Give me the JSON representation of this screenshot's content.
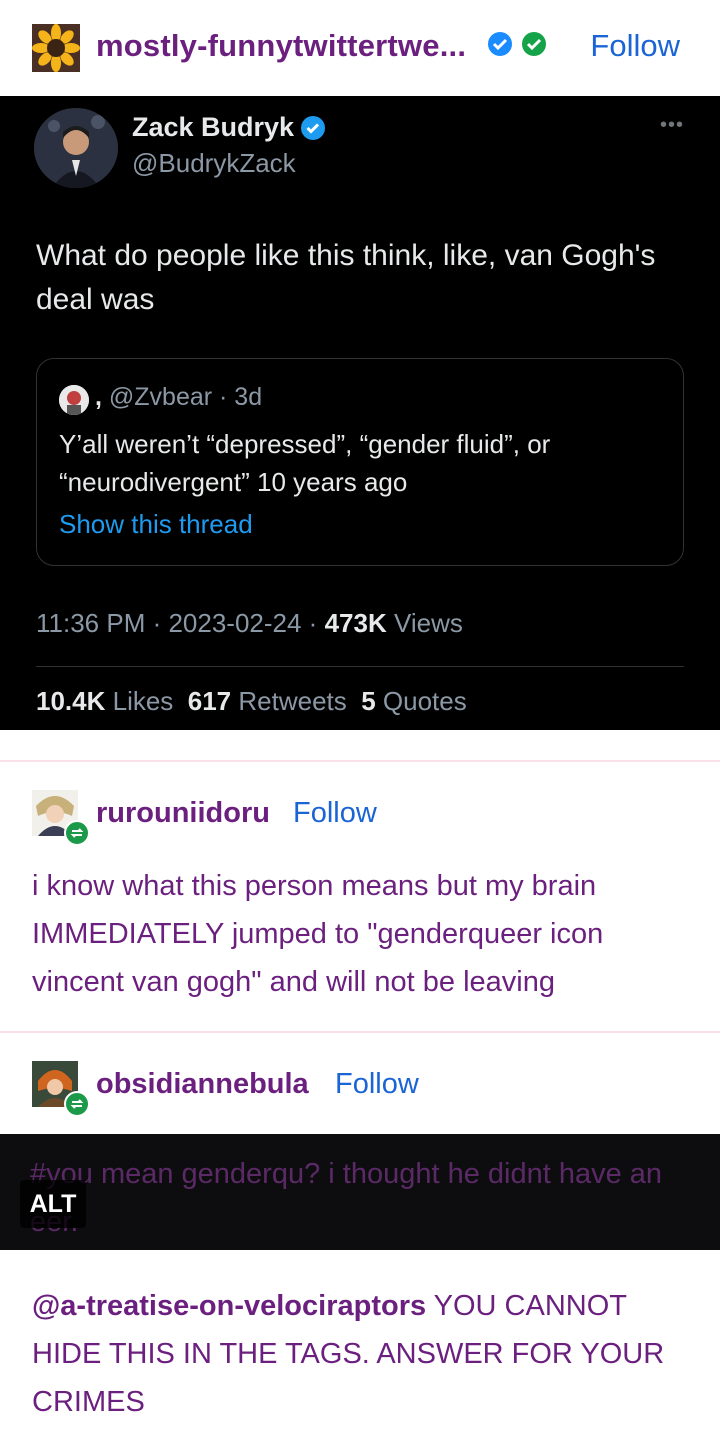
{
  "post": {
    "blog_name": "mostly-funnytwittertwe...",
    "follow_label": "Follow"
  },
  "tweet": {
    "display_name": "Zack Budryk",
    "handle": "@BudrykZack",
    "text": "What do people like this think, like, van Gogh's deal was",
    "quote": {
      "name_prefix": ",",
      "handle_time": "@Zvbear · 3d",
      "text": "Y’all weren’t “depressed”, “gender fluid”, or “neurodivergent” 10 years ago",
      "link": "Show this thread"
    },
    "time_date": "11:36 PM · 2023-02-24 · ",
    "views_count": "473K",
    "views_label": " Views",
    "likes_count": "10.4K",
    "likes_label": " Likes",
    "retweets_count": "617",
    "retweets_label": " Retweets",
    "quotes_count": "5",
    "quotes_label": " Quotes",
    "more": "•••"
  },
  "reblog1": {
    "username": "rurouniidoru",
    "follow_label": "Follow",
    "body": "i know what this person means but my brain IMMEDIATELY jumped to \"genderqueer icon vincent van gogh\" and will not be leaving"
  },
  "reblog2": {
    "username": "obsidiannebula",
    "follow_label": "Follow",
    "tag_text": "#you mean genderqu? i thought he didnt have an eer.",
    "alt_label": "ALT",
    "mention": "@a-treatise-on-velociraptors",
    "body": " YOU CANNOT HIDE THIS IN THE TAGS. ANSWER FOR YOUR CRIMES"
  },
  "colors": {
    "blog_purple": "#6b1f7e",
    "follow_blue": "#1a64d6",
    "twitter_blue": "#1d9bf0",
    "reblog_green": "#1b9a4a"
  }
}
